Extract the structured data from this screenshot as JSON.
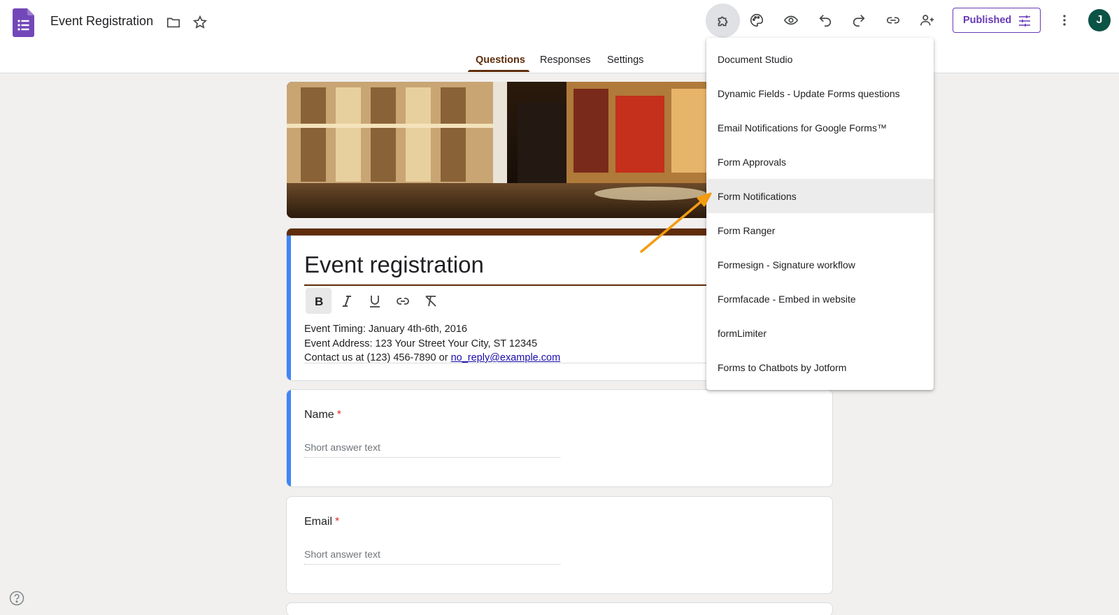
{
  "header": {
    "doc_title": "Event Registration",
    "published_label": "Published",
    "avatar_letter": "J"
  },
  "tabs": [
    {
      "label": "Questions",
      "active": true
    },
    {
      "label": "Responses",
      "active": false
    },
    {
      "label": "Settings",
      "active": false
    }
  ],
  "form": {
    "title": "Event registration",
    "description_lines": [
      "Event Timing: January 4th-6th, 2016",
      "Event Address: 123 Your Street Your City, ST 12345"
    ],
    "contact_prefix": "Contact us at (123) 456-7890 or ",
    "contact_email": "no_reply@example.com"
  },
  "questions": [
    {
      "label": "Name",
      "required_mark": "*",
      "placeholder": "Short answer text"
    },
    {
      "label": "Email",
      "required_mark": "*",
      "placeholder": "Short answer text"
    }
  ],
  "addons_menu": {
    "items": [
      "Document Studio",
      "Dynamic Fields - Update Forms questions",
      "Email Notifications for Google Forms™",
      "Form Approvals",
      "Form Notifications",
      "Form Ranger",
      "Formesign - Signature workflow",
      "Formfacade - Embed in website",
      "formLimiter",
      "Forms to Chatbots by Jotform"
    ],
    "highlighted": "Form Notifications"
  },
  "icons": [
    "forms-logo-icon",
    "folder-icon",
    "star-icon",
    "addons-puzzle-icon",
    "palette-icon",
    "eye-icon",
    "undo-icon",
    "redo-icon",
    "link-icon",
    "add-person-icon",
    "sliders-icon",
    "more-vert-icon",
    "bold-icon",
    "italic-icon",
    "underline-icon",
    "insert-link-icon",
    "clear-format-icon",
    "help-icon"
  ],
  "colors": {
    "theme": "#5f2d0b",
    "accent": "#673ab7",
    "focus_bar": "#4285f4",
    "annotation_arrow": "#f39c12"
  }
}
